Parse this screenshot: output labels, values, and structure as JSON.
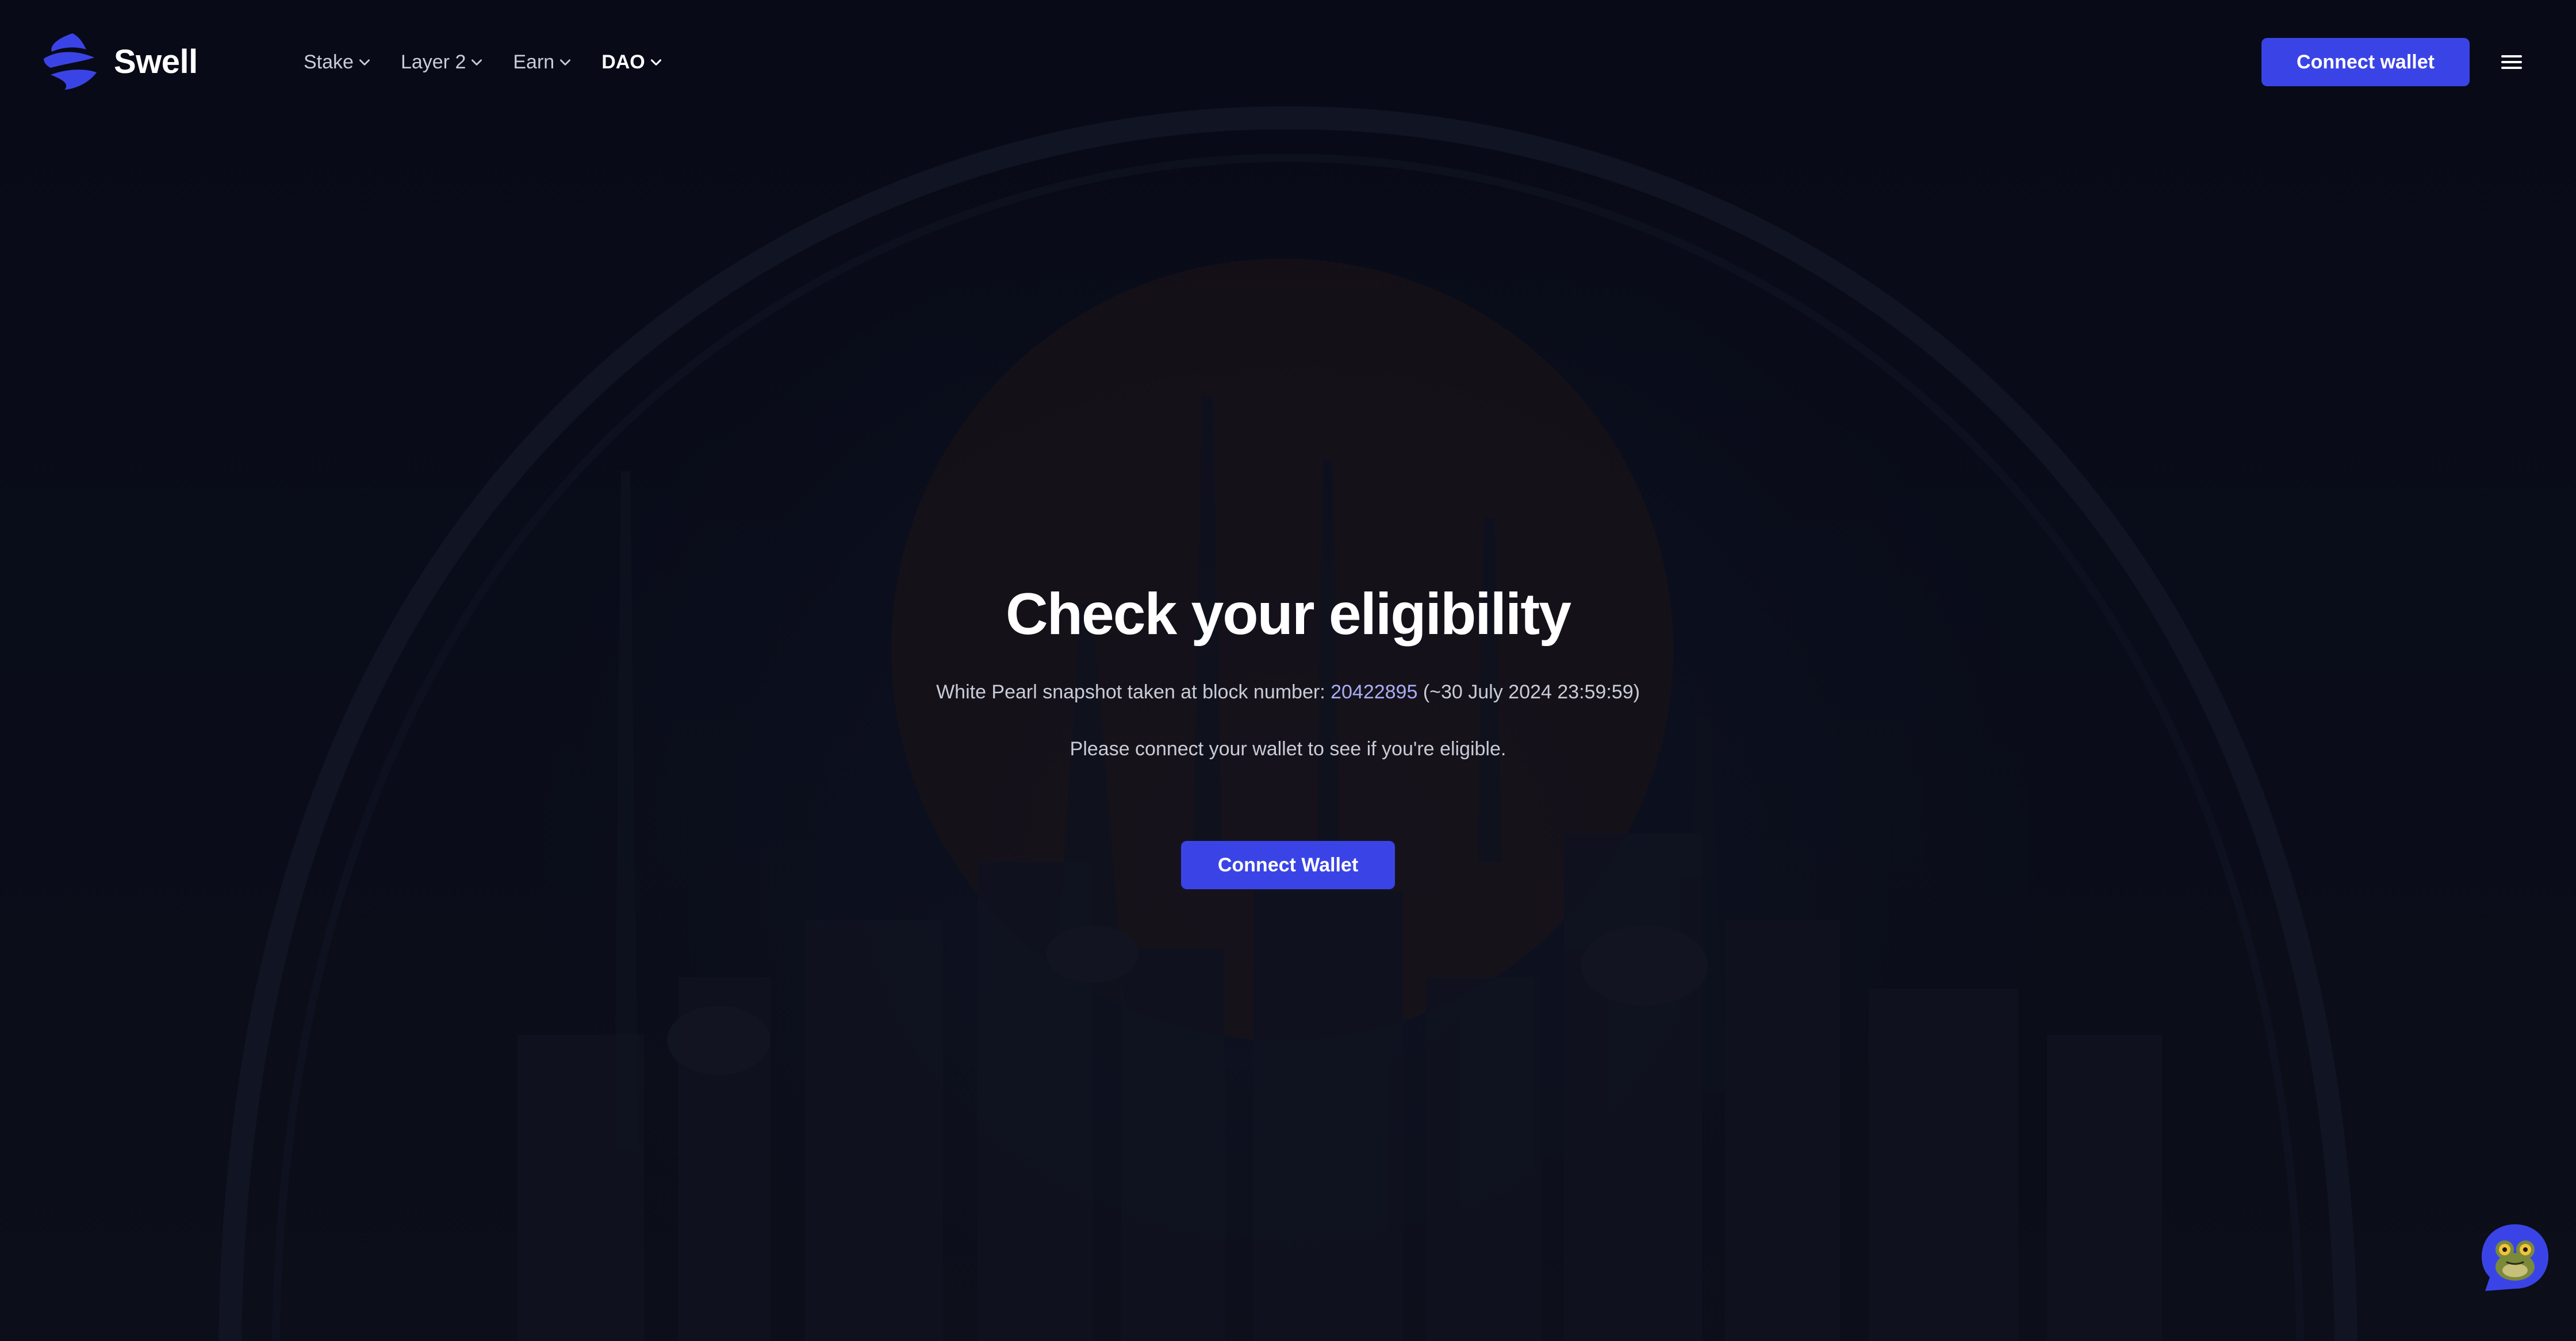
{
  "brand": {
    "name": "Swell",
    "accent_color": "#3a44e6"
  },
  "nav": {
    "items": [
      {
        "label": "Stake",
        "icon": "chevron-down-icon"
      },
      {
        "label": "Layer 2",
        "icon": "chevron-down-icon"
      },
      {
        "label": "Earn",
        "icon": "chevron-down-icon"
      },
      {
        "label": "DAO",
        "icon": "chevron-down-icon",
        "active": true
      }
    ],
    "connect_label": "Connect wallet",
    "menu_icon": "hamburger-menu-icon"
  },
  "hero": {
    "title": "Check your eligibility",
    "snapshot_prefix": "White Pearl snapshot taken at block number: ",
    "block_number": "20422895",
    "snapshot_suffix": " (~30 July 2024 23:59:59)",
    "hint": "Please connect your wallet to see if you're eligible.",
    "button_label": "Connect Wallet"
  },
  "chat": {
    "icon": "frog-chat-icon"
  }
}
